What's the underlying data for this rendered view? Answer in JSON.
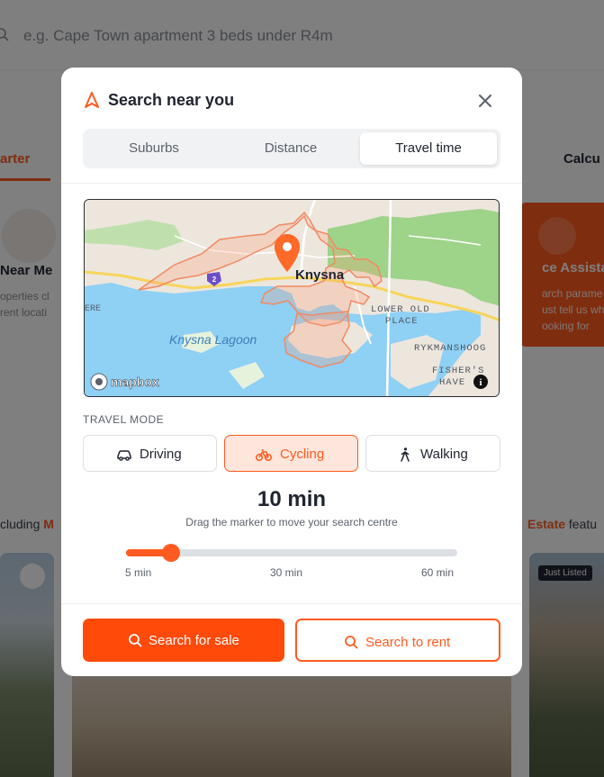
{
  "background": {
    "search_placeholder": "e.g. Cape Town apartment 3 beds under R4m",
    "tab_left": "arter",
    "tab_right": "Calcu",
    "card_left": {
      "title": "Near Me",
      "desc_line1": "operties cl",
      "desc_line2": "rent locati"
    },
    "card_right": {
      "title": "ce Assistan",
      "desc_line1": "arch parame",
      "desc_line2": "ust tell us wha",
      "desc_line3": "ooking for"
    },
    "including_text": "cluding ",
    "including_highlight": "M",
    "estate_highlight": "Estate",
    "estate_text": " featu",
    "photo_badge": "Just Listed"
  },
  "modal": {
    "title": "Search near you",
    "tabs": [
      {
        "label": "Suburbs",
        "active": false
      },
      {
        "label": "Distance",
        "active": false
      },
      {
        "label": "Travel time",
        "active": true
      }
    ],
    "map": {
      "town_label": "Knysna",
      "lagoon_label": "Knysna Lagoon",
      "lower_old_place_1": "LOWER OLD",
      "lower_old_place_2": "PLACE",
      "rykmanshoog": "RYKMANSHOOG",
      "fishers_haven_1": "FISHER'S",
      "fishers_haven_2": "HAVE",
      "left_fragment": "ERE",
      "route_shield": "2",
      "attribution": "mapbox",
      "info": "i"
    },
    "travel_mode_label": "TRAVEL MODE",
    "modes": [
      {
        "label": "Driving",
        "icon": "car-icon",
        "active": false
      },
      {
        "label": "Cycling",
        "icon": "bicycle-icon",
        "active": true
      },
      {
        "label": "Walking",
        "icon": "walking-icon",
        "active": false
      }
    ],
    "time_value": "10 min",
    "hint": "Drag the marker to move your search centre",
    "slider": {
      "min_label": "5 min",
      "mid_label": "30 min",
      "max_label": "60 min",
      "min": 5,
      "max": 60,
      "value": 10
    },
    "buttons": {
      "sale": "Search for sale",
      "rent": "Search to rent"
    }
  },
  "colors": {
    "accent": "#ff5a1f",
    "accent_soft": "#ffe6dc",
    "text": "#1f2430",
    "muted": "#5b616b",
    "water": "#8fd0f5",
    "park": "#9ed38a"
  }
}
